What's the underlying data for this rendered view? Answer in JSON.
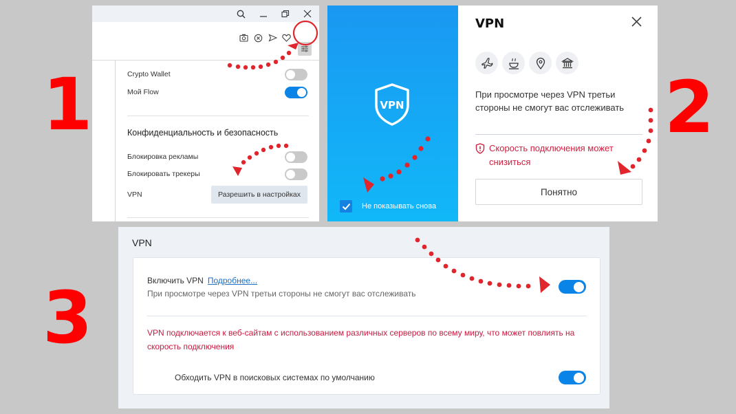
{
  "steps": [
    "1",
    "2",
    "3"
  ],
  "colors": {
    "annotation_red": "#ff0000",
    "toggle_on": "#0a84e6",
    "toggle_off": "#c9c9c9",
    "warning_red": "#d0203f",
    "link_blue": "#1a6fc4"
  },
  "panel1": {
    "titlebar_icons": [
      "search-icon",
      "minimize-icon",
      "restore-icon",
      "close-icon"
    ],
    "toolbar_icons": [
      "camera-icon",
      "block-icon",
      "send-icon",
      "heart-icon",
      "easy-setup-icon"
    ],
    "menu": {
      "rows": [
        {
          "label": "Crypto Wallet",
          "toggle": "off"
        },
        {
          "label": "Мой Flow",
          "toggle": "on"
        }
      ],
      "section_title": "Конфиденциальность и безопасность",
      "privacy_rows": [
        {
          "label": "Блокировка рекламы",
          "toggle": "off"
        },
        {
          "label": "Блокировать трекеры",
          "toggle": "off"
        }
      ],
      "vpn_label": "VPN",
      "vpn_button": "Разрешить в настройках"
    }
  },
  "panel2": {
    "shield_text": "VPN",
    "dont_show_label": "Не показывать снова",
    "dont_show_checked": true,
    "title": "VPN",
    "feature_icons": [
      "airplane-icon",
      "coffee-cup-icon",
      "location-pin-icon",
      "bank-icon"
    ],
    "description": "При просмотре через VPN третьи стороны не смогут вас отслеживать",
    "warning": "Скорость подключения может снизиться",
    "ok_button": "Понятно"
  },
  "panel3": {
    "title": "VPN",
    "enable_label": "Включить VPN",
    "more_link": "Подробнее...",
    "enable_description": "При просмотре через VPN третьи стороны не смогут вас отслеживать",
    "enable_toggle": "on",
    "warning": "VPN подключается к веб-сайтам с использованием различных серверов по всему миру, что может повлиять на скорость подключения",
    "bypass_label": "Обходить VPN в поисковых системах по умолчанию",
    "bypass_toggle": "on"
  }
}
